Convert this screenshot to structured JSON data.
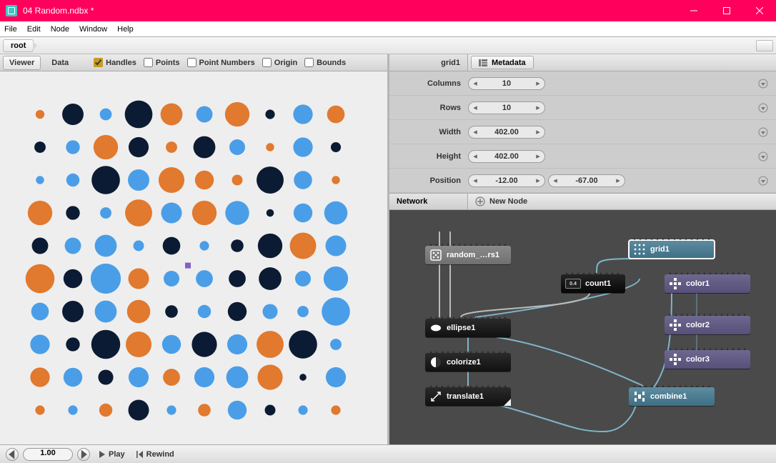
{
  "titlebar": {
    "title": "04 Random.ndbx *"
  },
  "menu": {
    "file": "File",
    "edit": "Edit",
    "node": "Node",
    "window": "Window",
    "help": "Help"
  },
  "breadcrumb": {
    "root": "root"
  },
  "viewer_tabs": {
    "viewer": "Viewer",
    "data": "Data"
  },
  "view_opts": {
    "handles": "Handles",
    "points": "Points",
    "point_numbers": "Point Numbers",
    "origin": "Origin",
    "bounds": "Bounds"
  },
  "props": {
    "node_name": "grid1",
    "metadata_label": "Metadata",
    "rows": [
      {
        "label": "Columns",
        "vals": [
          "10"
        ]
      },
      {
        "label": "Rows",
        "vals": [
          "10"
        ]
      },
      {
        "label": "Width",
        "vals": [
          "402.00"
        ]
      },
      {
        "label": "Height",
        "vals": [
          "402.00"
        ]
      },
      {
        "label": "Position",
        "vals": [
          "-12.00",
          "-67.00"
        ]
      }
    ]
  },
  "network": {
    "label": "Network",
    "new_node": "New Node",
    "nodes": {
      "random": "random_…rs1",
      "grid": "grid1",
      "count": "count1",
      "ellipse": "ellipse1",
      "colorize": "colorize1",
      "translate": "translate1",
      "combine": "combine1",
      "color1": "color1",
      "color2": "color2",
      "color3": "color3"
    },
    "count_badge": "0.4"
  },
  "transport": {
    "frame": "1.00",
    "play": "Play",
    "rewind": "Rewind"
  },
  "colors": {
    "orange": "#e1792e",
    "blue": "#4a9ee8",
    "navy": "#0b1b33",
    "canvas": "#eeeeee"
  },
  "viewer_dots": [
    {
      "c": 0,
      "r": 0,
      "sz": 0.28,
      "col": "orange"
    },
    {
      "c": 1,
      "r": 0,
      "sz": 0.68,
      "col": "navy"
    },
    {
      "c": 2,
      "r": 0,
      "sz": 0.38,
      "col": "blue"
    },
    {
      "c": 3,
      "r": 0,
      "sz": 0.88,
      "col": "navy"
    },
    {
      "c": 4,
      "r": 0,
      "sz": 0.7,
      "col": "orange"
    },
    {
      "c": 5,
      "r": 0,
      "sz": 0.52,
      "col": "blue"
    },
    {
      "c": 6,
      "r": 0,
      "sz": 0.78,
      "col": "orange"
    },
    {
      "c": 7,
      "r": 0,
      "sz": 0.3,
      "col": "navy"
    },
    {
      "c": 8,
      "r": 0,
      "sz": 0.62,
      "col": "blue"
    },
    {
      "c": 9,
      "r": 0,
      "sz": 0.56,
      "col": "orange"
    },
    {
      "c": 0,
      "r": 1,
      "sz": 0.36,
      "col": "navy"
    },
    {
      "c": 1,
      "r": 1,
      "sz": 0.44,
      "col": "blue"
    },
    {
      "c": 2,
      "r": 1,
      "sz": 0.78,
      "col": "orange"
    },
    {
      "c": 3,
      "r": 1,
      "sz": 0.64,
      "col": "navy"
    },
    {
      "c": 4,
      "r": 1,
      "sz": 0.36,
      "col": "orange"
    },
    {
      "c": 5,
      "r": 1,
      "sz": 0.7,
      "col": "navy"
    },
    {
      "c": 6,
      "r": 1,
      "sz": 0.5,
      "col": "blue"
    },
    {
      "c": 7,
      "r": 1,
      "sz": 0.26,
      "col": "orange"
    },
    {
      "c": 8,
      "r": 1,
      "sz": 0.62,
      "col": "blue"
    },
    {
      "c": 9,
      "r": 1,
      "sz": 0.32,
      "col": "navy"
    },
    {
      "c": 0,
      "r": 2,
      "sz": 0.26,
      "col": "blue"
    },
    {
      "c": 1,
      "r": 2,
      "sz": 0.42,
      "col": "blue"
    },
    {
      "c": 2,
      "r": 2,
      "sz": 0.9,
      "col": "navy"
    },
    {
      "c": 3,
      "r": 2,
      "sz": 0.68,
      "col": "blue"
    },
    {
      "c": 4,
      "r": 2,
      "sz": 0.82,
      "col": "orange"
    },
    {
      "c": 5,
      "r": 2,
      "sz": 0.6,
      "col": "orange"
    },
    {
      "c": 6,
      "r": 2,
      "sz": 0.34,
      "col": "orange"
    },
    {
      "c": 7,
      "r": 2,
      "sz": 0.86,
      "col": "navy"
    },
    {
      "c": 8,
      "r": 2,
      "sz": 0.58,
      "col": "blue"
    },
    {
      "c": 9,
      "r": 2,
      "sz": 0.26,
      "col": "orange"
    },
    {
      "c": 0,
      "r": 3,
      "sz": 0.78,
      "col": "orange"
    },
    {
      "c": 1,
      "r": 3,
      "sz": 0.44,
      "col": "navy"
    },
    {
      "c": 2,
      "r": 3,
      "sz": 0.36,
      "col": "blue"
    },
    {
      "c": 3,
      "r": 3,
      "sz": 0.86,
      "col": "orange"
    },
    {
      "c": 4,
      "r": 3,
      "sz": 0.66,
      "col": "blue"
    },
    {
      "c": 5,
      "r": 3,
      "sz": 0.78,
      "col": "orange"
    },
    {
      "c": 6,
      "r": 3,
      "sz": 0.76,
      "col": "blue"
    },
    {
      "c": 7,
      "r": 3,
      "sz": 0.24,
      "col": "navy"
    },
    {
      "c": 8,
      "r": 3,
      "sz": 0.6,
      "col": "blue"
    },
    {
      "c": 9,
      "r": 3,
      "sz": 0.74,
      "col": "blue"
    },
    {
      "c": 0,
      "r": 4,
      "sz": 0.52,
      "col": "navy"
    },
    {
      "c": 1,
      "r": 4,
      "sz": 0.52,
      "col": "blue"
    },
    {
      "c": 2,
      "r": 4,
      "sz": 0.7,
      "col": "blue"
    },
    {
      "c": 3,
      "r": 4,
      "sz": 0.34,
      "col": "blue"
    },
    {
      "c": 4,
      "r": 4,
      "sz": 0.56,
      "col": "navy"
    },
    {
      "c": 5,
      "r": 4,
      "sz": 0.3,
      "col": "blue"
    },
    {
      "c": 6,
      "r": 4,
      "sz": 0.4,
      "col": "navy"
    },
    {
      "c": 7,
      "r": 4,
      "sz": 0.78,
      "col": "navy"
    },
    {
      "c": 8,
      "r": 4,
      "sz": 0.84,
      "col": "orange"
    },
    {
      "c": 9,
      "r": 4,
      "sz": 0.66,
      "col": "blue"
    },
    {
      "c": 0,
      "r": 5,
      "sz": 0.92,
      "col": "orange"
    },
    {
      "c": 1,
      "r": 5,
      "sz": 0.6,
      "col": "navy"
    },
    {
      "c": 2,
      "r": 5,
      "sz": 0.96,
      "col": "blue"
    },
    {
      "c": 3,
      "r": 5,
      "sz": 0.66,
      "col": "orange"
    },
    {
      "c": 4,
      "r": 5,
      "sz": 0.5,
      "col": "blue"
    },
    {
      "c": 5,
      "r": 5,
      "sz": 0.54,
      "col": "blue"
    },
    {
      "c": 6,
      "r": 5,
      "sz": 0.54,
      "col": "navy"
    },
    {
      "c": 7,
      "r": 5,
      "sz": 0.72,
      "col": "navy"
    },
    {
      "c": 8,
      "r": 5,
      "sz": 0.5,
      "col": "blue"
    },
    {
      "c": 9,
      "r": 5,
      "sz": 0.78,
      "col": "blue"
    },
    {
      "c": 0,
      "r": 6,
      "sz": 0.56,
      "col": "blue"
    },
    {
      "c": 1,
      "r": 6,
      "sz": 0.68,
      "col": "navy"
    },
    {
      "c": 2,
      "r": 6,
      "sz": 0.7,
      "col": "blue"
    },
    {
      "c": 3,
      "r": 6,
      "sz": 0.74,
      "col": "orange"
    },
    {
      "c": 4,
      "r": 6,
      "sz": 0.4,
      "col": "navy"
    },
    {
      "c": 5,
      "r": 6,
      "sz": 0.42,
      "col": "blue"
    },
    {
      "c": 6,
      "r": 6,
      "sz": 0.6,
      "col": "navy"
    },
    {
      "c": 7,
      "r": 6,
      "sz": 0.48,
      "col": "blue"
    },
    {
      "c": 8,
      "r": 6,
      "sz": 0.36,
      "col": "blue"
    },
    {
      "c": 9,
      "r": 6,
      "sz": 0.9,
      "col": "blue"
    },
    {
      "c": 0,
      "r": 7,
      "sz": 0.62,
      "col": "blue"
    },
    {
      "c": 1,
      "r": 7,
      "sz": 0.44,
      "col": "navy"
    },
    {
      "c": 2,
      "r": 7,
      "sz": 0.92,
      "col": "navy"
    },
    {
      "c": 3,
      "r": 7,
      "sz": 0.82,
      "col": "orange"
    },
    {
      "c": 4,
      "r": 7,
      "sz": 0.6,
      "col": "blue"
    },
    {
      "c": 5,
      "r": 7,
      "sz": 0.8,
      "col": "navy"
    },
    {
      "c": 6,
      "r": 7,
      "sz": 0.64,
      "col": "blue"
    },
    {
      "c": 7,
      "r": 7,
      "sz": 0.86,
      "col": "orange"
    },
    {
      "c": 8,
      "r": 7,
      "sz": 0.9,
      "col": "navy"
    },
    {
      "c": 9,
      "r": 7,
      "sz": 0.36,
      "col": "blue"
    },
    {
      "c": 0,
      "r": 8,
      "sz": 0.62,
      "col": "orange"
    },
    {
      "c": 1,
      "r": 8,
      "sz": 0.6,
      "col": "blue"
    },
    {
      "c": 2,
      "r": 8,
      "sz": 0.48,
      "col": "navy"
    },
    {
      "c": 3,
      "r": 8,
      "sz": 0.64,
      "col": "blue"
    },
    {
      "c": 4,
      "r": 8,
      "sz": 0.54,
      "col": "orange"
    },
    {
      "c": 5,
      "r": 8,
      "sz": 0.64,
      "col": "blue"
    },
    {
      "c": 6,
      "r": 8,
      "sz": 0.7,
      "col": "blue"
    },
    {
      "c": 7,
      "r": 8,
      "sz": 0.8,
      "col": "orange"
    },
    {
      "c": 8,
      "r": 8,
      "sz": 0.22,
      "col": "navy"
    },
    {
      "c": 9,
      "r": 8,
      "sz": 0.64,
      "col": "blue"
    },
    {
      "c": 0,
      "r": 9,
      "sz": 0.3,
      "col": "orange"
    },
    {
      "c": 1,
      "r": 9,
      "sz": 0.3,
      "col": "blue"
    },
    {
      "c": 2,
      "r": 9,
      "sz": 0.42,
      "col": "orange"
    },
    {
      "c": 3,
      "r": 9,
      "sz": 0.66,
      "col": "navy"
    },
    {
      "c": 4,
      "r": 9,
      "sz": 0.3,
      "col": "blue"
    },
    {
      "c": 5,
      "r": 9,
      "sz": 0.4,
      "col": "orange"
    },
    {
      "c": 6,
      "r": 9,
      "sz": 0.6,
      "col": "blue"
    },
    {
      "c": 7,
      "r": 9,
      "sz": 0.34,
      "col": "navy"
    },
    {
      "c": 8,
      "r": 9,
      "sz": 0.3,
      "col": "blue"
    },
    {
      "c": 9,
      "r": 9,
      "sz": 0.3,
      "col": "orange"
    }
  ]
}
